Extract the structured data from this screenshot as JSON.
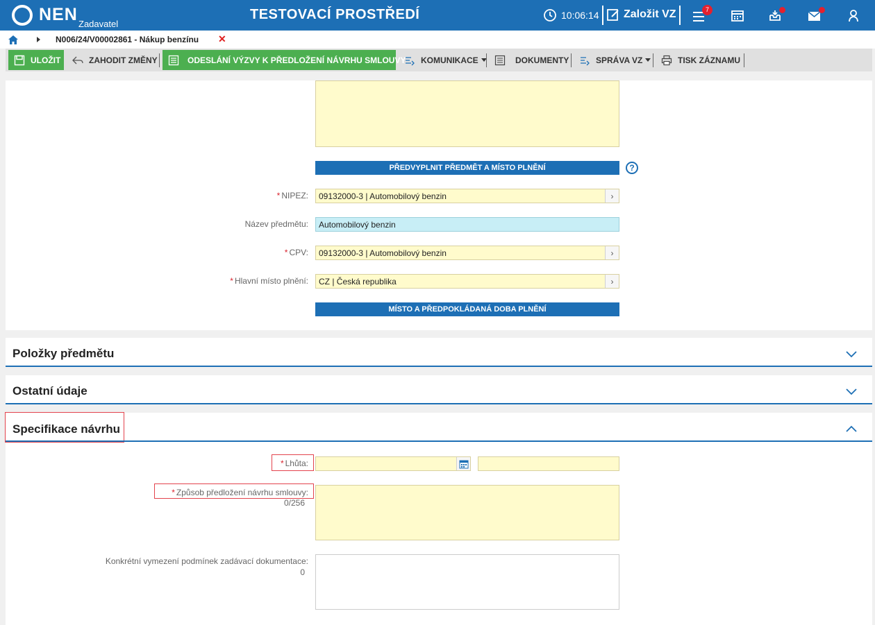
{
  "topbar": {
    "logo_text": "NEN",
    "logo_sub": "Zadavatel",
    "env_title": "TESTOVACÍ PROSTŘEDÍ",
    "clock": "10:06:14",
    "create_label": "Založit VZ",
    "menu_badge": "7",
    "icons": [
      "clock-icon",
      "edit-icon",
      "menu-icon",
      "calendar-icon",
      "inbox-icon",
      "mail-icon",
      "user-icon"
    ]
  },
  "breadcrumb": {
    "text": "N006/24/V00002861 - Nákup benzínu",
    "close": "✕"
  },
  "toolbar": {
    "save": "ULOŽIT",
    "discard": "ZAHODIT ZMĚNY",
    "send": "ODESLÁNÍ VÝZVY K PŘEDLOŽENÍ NÁVRHU SMLOUVY",
    "communication": "KOMUNIKACE",
    "documents": "DOKUMENTY",
    "manage": "SPRÁVA VZ",
    "print": "TISK ZÁZNAMU"
  },
  "subject": {
    "prefill_button": "PŘEDVYPLNIT PŘEDMĚT A MÍSTO PLNĚNÍ",
    "help": "?",
    "nipez_label": "NIPEZ:",
    "nipez_value": "09132000-3 | Automobilový benzin",
    "name_label": "Název předmětu:",
    "name_value": "Automobilový benzin",
    "cpv_label": "CPV:",
    "cpv_value": "09132000-3 | Automobilový benzin",
    "place_label": "Hlavní místo plnění:",
    "place_value": "CZ | Česká republika",
    "place_time_button": "MÍSTO A PŘEDPOKLÁDANÁ DOBA PLNĚNÍ"
  },
  "sections": {
    "items": "Položky předmětu",
    "other": "Ostatní údaje",
    "spec": "Specifikace návrhu"
  },
  "spec": {
    "deadline_label": "Lhůta:",
    "deadline_date": "",
    "deadline_time": "",
    "method_label": "Způsob předložení návrhu smlouvy:",
    "method_counter": "0/256",
    "method_value": "",
    "conditions_label": "Konkrétní vymezení podmínek zadávací dokumentace:",
    "conditions_counter": "0",
    "conditions_value": ""
  },
  "colors": {
    "brand": "#1d6fb5",
    "green": "#4caf50",
    "field_yellow": "#fffbcc",
    "field_blue": "#c8eef6",
    "required": "#d9232e"
  }
}
